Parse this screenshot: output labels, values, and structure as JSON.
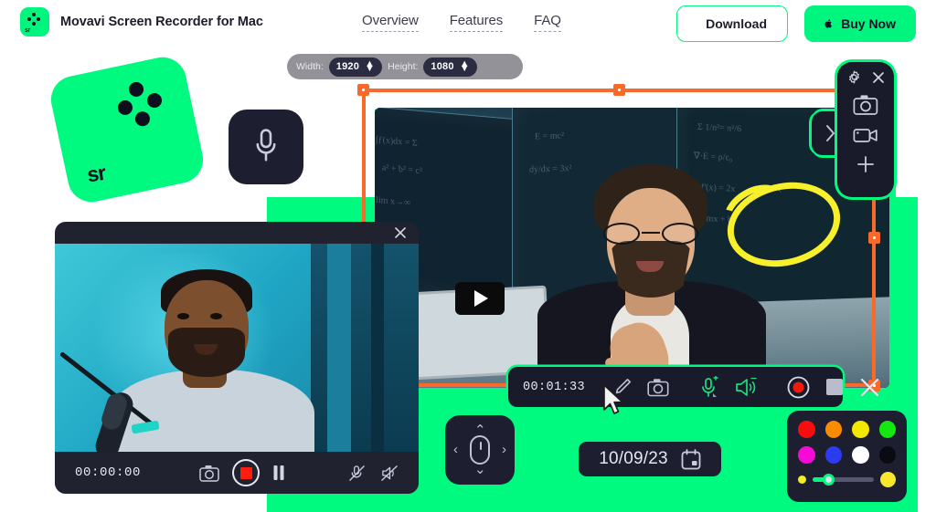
{
  "header": {
    "brand_title": "Movavi Screen Recorder for Mac",
    "logo_text": "sr",
    "nav": [
      {
        "label": "Overview",
        "name": "nav-overview"
      },
      {
        "label": "Features",
        "name": "nav-features"
      },
      {
        "label": "FAQ",
        "name": "nav-faq"
      }
    ],
    "download_label": "Download",
    "buy_label": "Buy Now"
  },
  "logo_card": {
    "text": "sr"
  },
  "size_bar": {
    "width_label": "Width:",
    "width_value": "1920",
    "height_label": "Height:",
    "height_value": "1080"
  },
  "recording_toolbar": {
    "time": "00:01:33",
    "icons": [
      "pencil-icon",
      "camera-icon",
      "microphone-icon",
      "speaker-icon",
      "record-icon",
      "stop-icon",
      "close-icon"
    ]
  },
  "cam_window": {
    "time": "00:00:00",
    "icons": [
      "close-icon",
      "camera-icon",
      "stop-record-icon",
      "pause-icon",
      "mic-muted-icon",
      "speaker-muted-icon"
    ]
  },
  "side_panel": {
    "icons": [
      "gear-icon",
      "close-icon",
      "camera-icon",
      "video-camera-icon",
      "plus-icon",
      "chevron-right-icon"
    ]
  },
  "mouse_widget": {
    "up": "⌃",
    "down": "⌄",
    "left": "‹",
    "right": "›",
    "icon": "mouse-icon"
  },
  "date_widget": {
    "value": "10/09/23",
    "icon": "calendar-icon"
  },
  "palette": {
    "row1": [
      "#f70d0d",
      "#fb8b00",
      "#f5e800",
      "#13e810"
    ],
    "row2": [
      "#f50bd5",
      "#2b3cf0",
      "#ffffff",
      "#0a0a12"
    ],
    "slider_color": "#f7e92a",
    "slider_fill": "#00f97f"
  },
  "colors": {
    "accent_green": "#00f97f",
    "selection_orange": "#f96a2a",
    "dark_ui": "#1d1f30",
    "record_red": "#ff1d0f",
    "highlight_yellow": "#f7f02a"
  },
  "main_video": {
    "play_icon": "play-icon"
  },
  "mic_tile": {
    "icon": "microphone-icon"
  }
}
